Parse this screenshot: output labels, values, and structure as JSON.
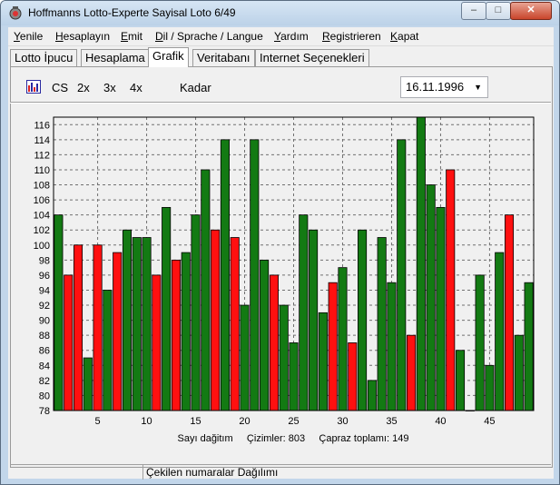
{
  "window": {
    "title": "Hoffmanns Lotto-Experte Sayisal Loto 6/49"
  },
  "menu": [
    {
      "first": "Y",
      "rest": "enile"
    },
    {
      "first": "H",
      "rest": "esaplayın"
    },
    {
      "first": "E",
      "rest": "mit"
    },
    {
      "first": "D",
      "rest": "il / Sprache / Langue"
    },
    {
      "first": "Y",
      "rest": "ardım"
    },
    {
      "first": "R",
      "rest": "egistrieren"
    },
    {
      "first": "K",
      "rest": "apat"
    }
  ],
  "tabs": [
    "Lotto İpucu",
    "Hesaplama",
    "Grafik",
    "Veritabanı",
    "Internet Seçenekleri"
  ],
  "active_tab": "Grafik",
  "toolbar": {
    "cs": "CS",
    "zoom2": "2x",
    "zoom3": "3x",
    "zoom4": "4x",
    "kadar": "Kadar",
    "date": "16.11.1996"
  },
  "info": "Sayı dağitım     Çizimler: 803     Çapraz toplamı: 149",
  "status": "Çekilen numaralar Dağılımı",
  "colors": {
    "green": "#137a13",
    "red": "#ff1010",
    "grid": "#707070"
  },
  "chart_data": {
    "type": "bar",
    "ylim": [
      78,
      117
    ],
    "yticks": [
      78,
      80,
      82,
      84,
      86,
      88,
      90,
      92,
      94,
      96,
      98,
      100,
      102,
      104,
      106,
      108,
      110,
      112,
      114,
      116
    ],
    "xticks": [
      5,
      10,
      15,
      20,
      25,
      30,
      35,
      40,
      45
    ],
    "categories": [
      1,
      2,
      3,
      4,
      5,
      6,
      7,
      8,
      9,
      10,
      11,
      12,
      13,
      14,
      15,
      16,
      17,
      18,
      19,
      20,
      21,
      22,
      23,
      24,
      25,
      26,
      27,
      28,
      29,
      30,
      31,
      32,
      33,
      34,
      35,
      36,
      37,
      38,
      39,
      40,
      41,
      42,
      43,
      44,
      45,
      46,
      47,
      48,
      49
    ],
    "values": [
      104,
      96,
      100,
      85,
      100,
      94,
      99,
      102,
      101,
      101,
      96,
      105,
      98,
      99,
      104,
      110,
      102,
      114,
      101,
      92,
      114,
      98,
      96,
      92,
      87,
      104,
      102,
      91,
      95,
      97,
      87,
      102,
      82,
      101,
      95,
      114,
      88,
      117,
      108,
      105,
      110,
      86,
      78,
      96,
      84,
      99,
      104,
      88,
      95
    ],
    "bar_colors": [
      "green",
      "red",
      "red",
      "green",
      "red",
      "green",
      "red",
      "green",
      "green",
      "green",
      "red",
      "green",
      "red",
      "green",
      "green",
      "green",
      "red",
      "green",
      "red",
      "green",
      "green",
      "green",
      "red",
      "green",
      "green",
      "green",
      "green",
      "green",
      "red",
      "green",
      "red",
      "green",
      "green",
      "green",
      "green",
      "green",
      "red",
      "green",
      "green",
      "green",
      "red",
      "green",
      "green",
      "green",
      "green",
      "green",
      "red",
      "green",
      "green"
    ]
  }
}
